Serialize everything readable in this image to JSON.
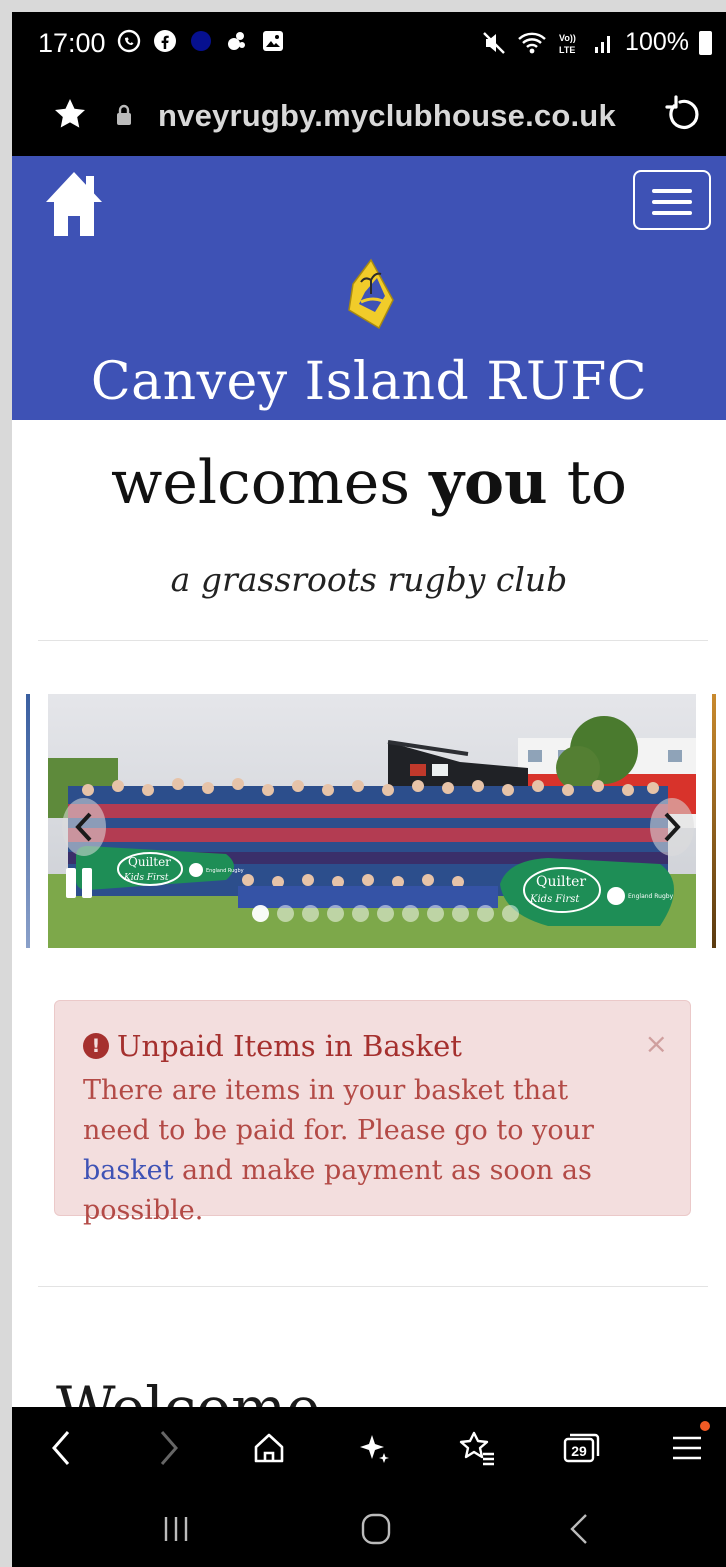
{
  "status_bar": {
    "time": "17:00",
    "battery": "100%",
    "left_icons": [
      "whatsapp-icon",
      "facebook-icon",
      "messenger-icon",
      "app-icon",
      "gallery-icon"
    ],
    "right_icons": [
      "mute-icon",
      "wifi-icon",
      "volte-icon",
      "signal-icon",
      "battery-icon"
    ]
  },
  "browser": {
    "url": "nveyrugby.myclubhouse.co.uk",
    "tabs_count": "29"
  },
  "site": {
    "club_name": "Canvey Island RUFC",
    "welcome_prefix": "welcomes",
    "welcome_emphasis": "you",
    "welcome_suffix": "to",
    "tagline": "a grassroots rugby club",
    "section_heading": "Welcome"
  },
  "carousel": {
    "slide_count": 11,
    "active_index": 0,
    "banner_left": "Quilter",
    "banner_left_sub": "Kids First",
    "banner_right": "Quilter",
    "banner_right_sub": "Kids First",
    "rfu_text": "England Rugby"
  },
  "alert": {
    "title": "Unpaid Items in Basket",
    "body_before_link": "There are items in your basket that need to be paid for. Please go to your ",
    "link_text": "basket",
    "body_after_link": " and make payment as soon as possible.",
    "close_symbol": "×",
    "icon_symbol": "!"
  },
  "colors": {
    "brand_blue": "#3e52b5",
    "alert_bg": "#f3dede",
    "alert_text": "#a5302e",
    "notification": "#f15a24"
  }
}
